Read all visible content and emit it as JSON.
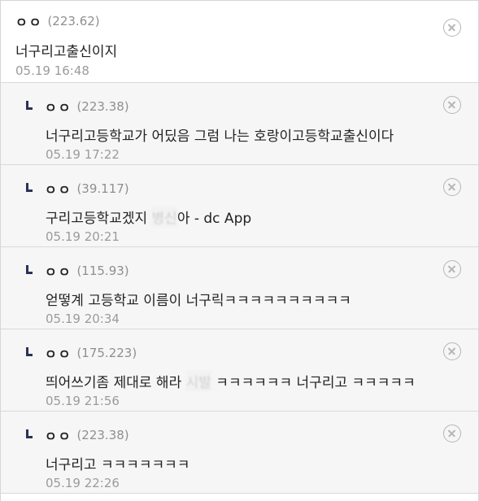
{
  "comments": [
    {
      "nick": "ㅇㅇ",
      "ip": "(223.62)",
      "text": "너구리고출신이지",
      "time": "05.19 16:48",
      "reply": false
    },
    {
      "nick": "ㅇㅇ",
      "ip": "(223.38)",
      "text": "너구리고등학교가 어딨음 그럼 나는 호랑이고등학교출신이다",
      "time": "05.19 17:22",
      "reply": true
    },
    {
      "nick": "ㅇㅇ",
      "ip": "(39.117)",
      "text_pre": "구리고등학교겠지 ",
      "text_blur": "병신",
      "text_post": "아 - dc App",
      "time": "05.19 20:21",
      "reply": true
    },
    {
      "nick": "ㅇㅇ",
      "ip": "(115.93)",
      "text": "얻떻계 고등학교 이름이 너구릭ㅋㅋㅋㅋㅋㅋㅋㅋㅋㅋ",
      "time": "05.19 20:34",
      "reply": true
    },
    {
      "nick": "ㅇㅇ",
      "ip": "(175.223)",
      "text_pre": "띄어쓰기좀 제대로 해라 ",
      "text_blur": "시발",
      "text_post": " ㅋㅋㅋㅋㅋㅋ 너구리고 ㅋㅋㅋㅋㅋ",
      "time": "05.19 21:56",
      "reply": true
    },
    {
      "nick": "ㅇㅇ",
      "ip": "(223.38)",
      "text": "너구리고 ㅋㅋㅋㅋㅋㅋㅋ",
      "time": "05.19 22:26",
      "reply": true
    }
  ],
  "icons": {
    "reply_marker": "reply-arrow-icon",
    "delete": "delete-circle-x-icon"
  },
  "colors": {
    "reply_background": "#f6f6f6",
    "reply_marker": "#2c3256",
    "meta_text": "#9b9b9b"
  }
}
